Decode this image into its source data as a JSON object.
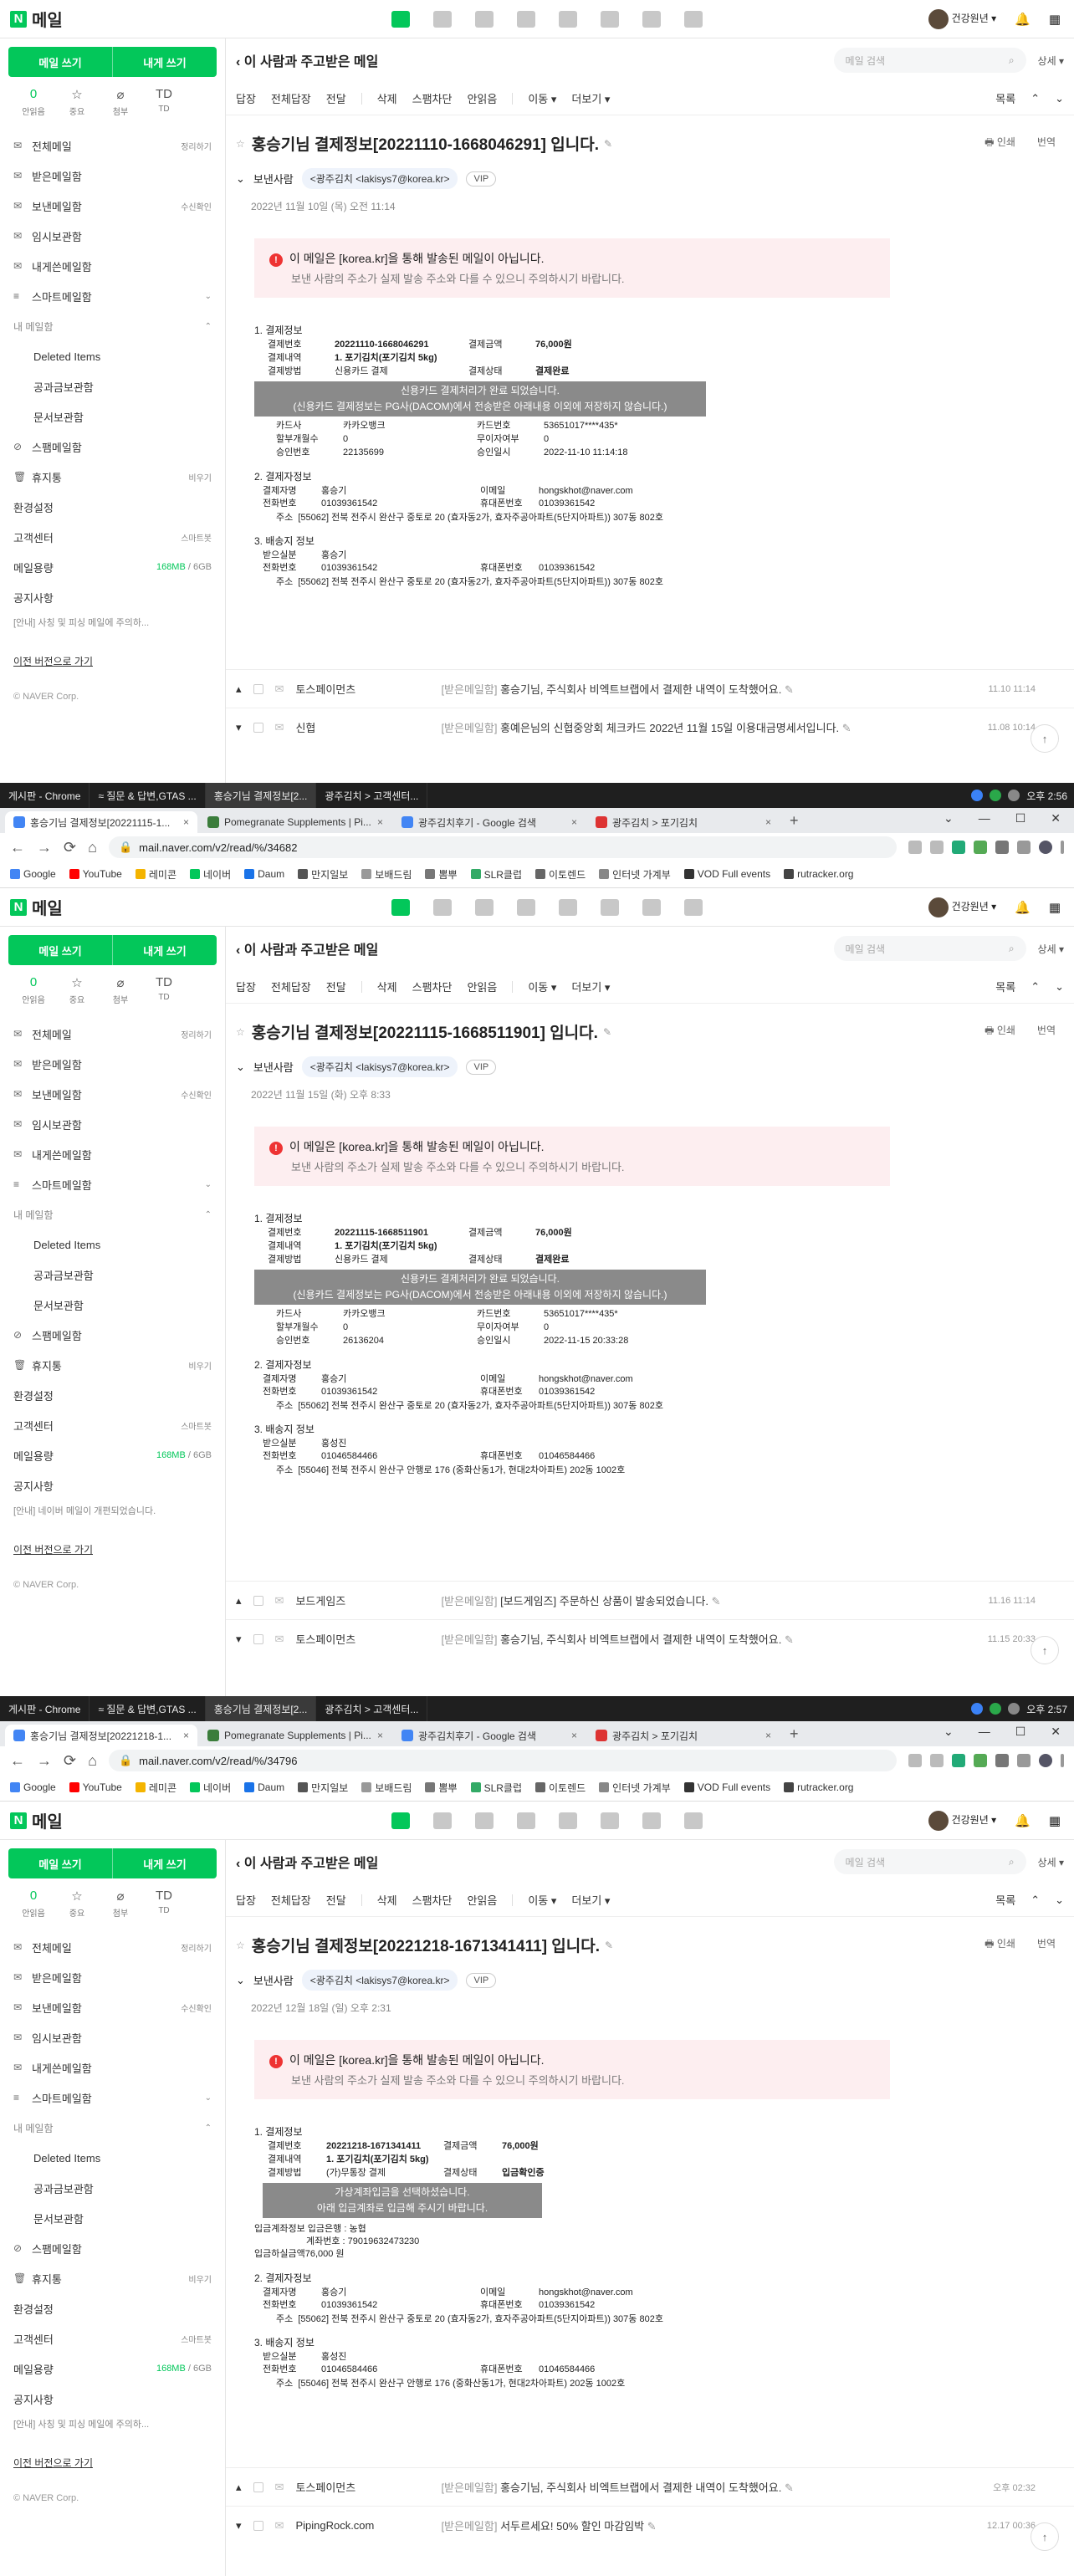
{
  "app": {
    "logo_letter": "N",
    "logo_text": "메일",
    "user_name": "건강원년",
    "write_label": "메일 쓰기",
    "self_write_label": "내게 쓰기",
    "quick": [
      {
        "value": "0",
        "label": "안읽음"
      },
      {
        "icon": "☆",
        "label": "중요"
      },
      {
        "icon": "⌀",
        "label": "첨부"
      },
      {
        "icon": "TD",
        "label": "TD"
      }
    ],
    "menu": [
      {
        "icon": "✉",
        "label": "전체메일",
        "sub": "정리하기"
      },
      {
        "icon": "✉",
        "label": "받은메일함",
        "sub": ""
      },
      {
        "icon": "✉",
        "label": "보낸메일함",
        "sub": "수신확인"
      },
      {
        "icon": "✉",
        "label": "임시보관함",
        "sub": ""
      },
      {
        "icon": "✉",
        "label": "내게쓴메일함",
        "sub": ""
      }
    ],
    "smart": "스마트메일함",
    "my_box": "내 메일함",
    "my_items": [
      "Deleted Items",
      "공과금보관함",
      "문서보관함"
    ],
    "spam": "스팸메일함",
    "trash": "휴지통",
    "trash_sub": "비우기",
    "settings": "환경설정",
    "support": "고객센터",
    "support_sub": "스마트봇",
    "quota_label": "메일용량",
    "quota_used": "168MB",
    "quota_total": "/ 6GB",
    "notice_label": "공지사항",
    "old_version": "이전 버전으로 가기",
    "corp": "© NAVER Corp.",
    "back_label": "이 사람과 주고받은 메일",
    "search_placeholder": "메일 검색",
    "detail_label": "상세 ▾",
    "toolbar": [
      "답장",
      "전체답장",
      "전달",
      "삭제",
      "스팸차단",
      "안읽음",
      "이동 ▾",
      "더보기 ▾"
    ],
    "toolbar_right": "목록",
    "print": "인쇄",
    "translate": "번역",
    "sender_label": "보낸사람",
    "vip": "VIP",
    "warn_title": "이 메일은 [korea.kr]을 통해 발송된 메일이 아닙니다.",
    "warn_desc": "보낸 사람의 주소가 실제 발송 주소와 다를 수 있으니 주의하시기 바랍니다.",
    "card_banner1": "신용카드 결제처리가 완료 되었습니다.",
    "card_banner2": "(신용카드 결제정보는 PG사(DACOM)에서 전송받은 아래내용 이외에 저장하지 않습니다.)"
  },
  "labels": {
    "sec1": "1. 결제정보",
    "order_no": "결제번호",
    "item": "결제내역",
    "method": "결제방법",
    "amount": "결제금액",
    "status": "결제상태",
    "card": "카드사",
    "card_no": "카드번호",
    "installment": "할부개월수",
    "free_inst": "무이자여부",
    "approval": "승인번호",
    "approval_date": "승인일시",
    "sec2": "2. 결제자정보",
    "payer": "결제자명",
    "email": "이메일",
    "phone": "전화번호",
    "mobile": "휴대폰번호",
    "addr": "주소",
    "sec3": "3. 배송지 정보",
    "recipient": "받으실분",
    "deposit_account": "입금계좌정보",
    "deposit_amount": "입금하실금액"
  },
  "screens": [
    {
      "taskbar": null,
      "subject": "홍승기님 결제정보[20221110-1668046291] 입니다.",
      "sender": "<광주김치 <lakisys7@korea.kr>",
      "date": "2022년 11월 10일 (목) 오전 11:14",
      "order_no": "20221110-1668046291",
      "amount": "76,000원",
      "item": "1. 포기김치(포기김치 5kg)",
      "method": "신용카드 결제",
      "status": "결제완료",
      "card": "카카오뱅크",
      "card_no": "53651017****435*",
      "installment": "0",
      "free_inst": "0",
      "approval": "22135699",
      "approval_date": "2022-11-10 11:14:18",
      "payer": "홍승기",
      "email": "hongskhot@naver.com",
      "phone": "01039361542",
      "mobile": "01039361542",
      "addr": "[55062] 전북 전주시 완산구 중토로 20 (효자동2가, 효자주공아파트(5단지아파트)) 307동 802호",
      "recipient": "홍승기",
      "r_phone": "01039361542",
      "r_mobile": "01039361542",
      "r_addr": "[55062] 전북 전주시 완산구 중토로 20 (효자동2가, 효자주공아파트(5단지아파트)) 307동 802호",
      "notice": "[안내] 사칭 및 피싱 메일에 주의하...",
      "list": [
        {
          "from": "토스페이먼츠",
          "tag": "[받은메일함]",
          "subj": "홍승기님, 주식회사 비엑트브랩에서 결제한 내역이 도착했어요.",
          "time": "11.10 11:14"
        },
        {
          "from": "신협",
          "tag": "[받은메일함]",
          "subj": "홍예은님의 신협중앙회 체크카드 2022년 11월 15일 이용대금명세서입니다.",
          "time": "11.08 10:14"
        }
      ]
    },
    {
      "taskbar": {
        "items": [
          "게시판 - Chrome",
          "≈ 질문 & 답변,GTAS ...",
          "홍승기님 결제정보[2...",
          "광주김치 > 고객센터..."
        ],
        "time": "오후 2:56"
      },
      "tabs": [
        "홍승기님 결제정보[20221115-1...",
        "Pomegranate Supplements | Pi...",
        "광주김치후기 - Google 검색",
        "광주김치 > 포기김치"
      ],
      "url": "mail.naver.com/v2/read/%/34682",
      "bookmarks": [
        "Google",
        "YouTube",
        "레미콘",
        "네이버",
        "Daum",
        "만지일보",
        "보배드림",
        "뽐뿌",
        "SLR클럽",
        "이토렌드",
        "인터넷 가계부",
        "VOD Full events",
        "rutracker.org"
      ],
      "subject": "홍승기님 결제정보[20221115-1668511901] 입니다.",
      "sender": "<광주김치 <lakisys7@korea.kr>",
      "date": "2022년 11월 15일 (화) 오후 8:33",
      "order_no": "20221115-1668511901",
      "amount": "76,000원",
      "item": "1. 포기김치(포기김치 5kg)",
      "method": "신용카드 결제",
      "status": "결제완료",
      "card": "카카오뱅크",
      "card_no": "53651017****435*",
      "installment": "0",
      "free_inst": "0",
      "approval": "26136204",
      "approval_date": "2022-11-15 20:33:28",
      "payer": "홍승기",
      "email": "hongskhot@naver.com",
      "phone": "01039361542",
      "mobile": "01039361542",
      "addr": "[55062] 전북 전주시 완산구 중토로 20 (효자동2가, 효자주공아파트(5단지아파트)) 307동 802호",
      "recipient": "홍성진",
      "r_phone": "01046584466",
      "r_mobile": "01046584466",
      "r_addr": "[55046] 전북 전주시 완산구 안행로 176 (중화산동1가, 현대2차아파트) 202동 1002호",
      "notice": "[안내] 네이버 메일이 개편되었습니다.",
      "list": [
        {
          "from": "보드게임즈",
          "tag": "[받은메일함]",
          "subj": "[보드게임즈] 주문하신 상품이 발송되었습니다.",
          "time": "11.16 11:14"
        },
        {
          "from": "토스페이먼츠",
          "tag": "[받은메일함]",
          "subj": "홍승기님, 주식회사 비엑트브랩에서 결제한 내역이 도착했어요.",
          "time": "11.15 20:33"
        }
      ]
    },
    {
      "taskbar": {
        "items": [
          "게시판 - Chrome",
          "≈ 질문 & 답변,GTAS ...",
          "홍승기님 결제정보[2...",
          "광주김치 > 고객센터..."
        ],
        "time": "오후 2:57"
      },
      "tabs": [
        "홍승기님 결제정보[20221218-1...",
        "Pomegranate Supplements | Pi...",
        "광주김치후기 - Google 검색",
        "광주김치 > 포기김치"
      ],
      "url": "mail.naver.com/v2/read/%/34796",
      "bookmarks": [
        "Google",
        "YouTube",
        "레미콘",
        "네이버",
        "Daum",
        "만지일보",
        "보배드림",
        "뽐뿌",
        "SLR클럽",
        "이토렌드",
        "인터넷 가계부",
        "VOD Full events",
        "rutracker.org"
      ],
      "subject": "홍승기님 결제정보[20221218-1671341411] 입니다.",
      "sender": "<광주김치 <lakisys7@korea.kr>",
      "date": "2022년 12월 18일 (일) 오후 2:31",
      "order_no": "20221218-1671341411",
      "amount": "76,000원",
      "item": "1. 포기김치(포기김치 5kg)",
      "method": "(가)무통장 결제",
      "status": "입금확인중",
      "bank_banner1": "가상계좌입금을 선택하셨습니다.",
      "bank_banner2": "아래 입금계좌로 입금해 주시기 바랍니다.",
      "bank": "입금은행 : 농협",
      "account": "계좌번호 : 79019632473230",
      "deposit": "76,000 원",
      "payer": "홍승기",
      "email": "hongskhot@naver.com",
      "phone": "01039361542",
      "mobile": "01039361542",
      "addr": "[55062] 전북 전주시 완산구 중토로 20 (효자동2가, 효자주공아파트(5단지아파트)) 307동 802호",
      "recipient": "홍성진",
      "r_phone": "01046584466",
      "r_mobile": "01046584466",
      "r_addr": "[55046] 전북 전주시 완산구 안행로 176 (중화산동1가, 현대2차아파트) 202동 1002호",
      "notice": "[안내] 사칭 및 피싱 메일에 주의하...",
      "list": [
        {
          "from": "토스페이먼츠",
          "tag": "[받은메일함]",
          "subj": "홍승기님, 주식회사 비엑트브랩에서 결제한 내역이 도착했어요.",
          "time": "오후 02:32"
        },
        {
          "from": "PipingRock.com",
          "tag": "[받은메일함]",
          "subj": "서두르세요! 50% 할인 마감임박",
          "time": "12.17 00:36"
        }
      ]
    }
  ]
}
